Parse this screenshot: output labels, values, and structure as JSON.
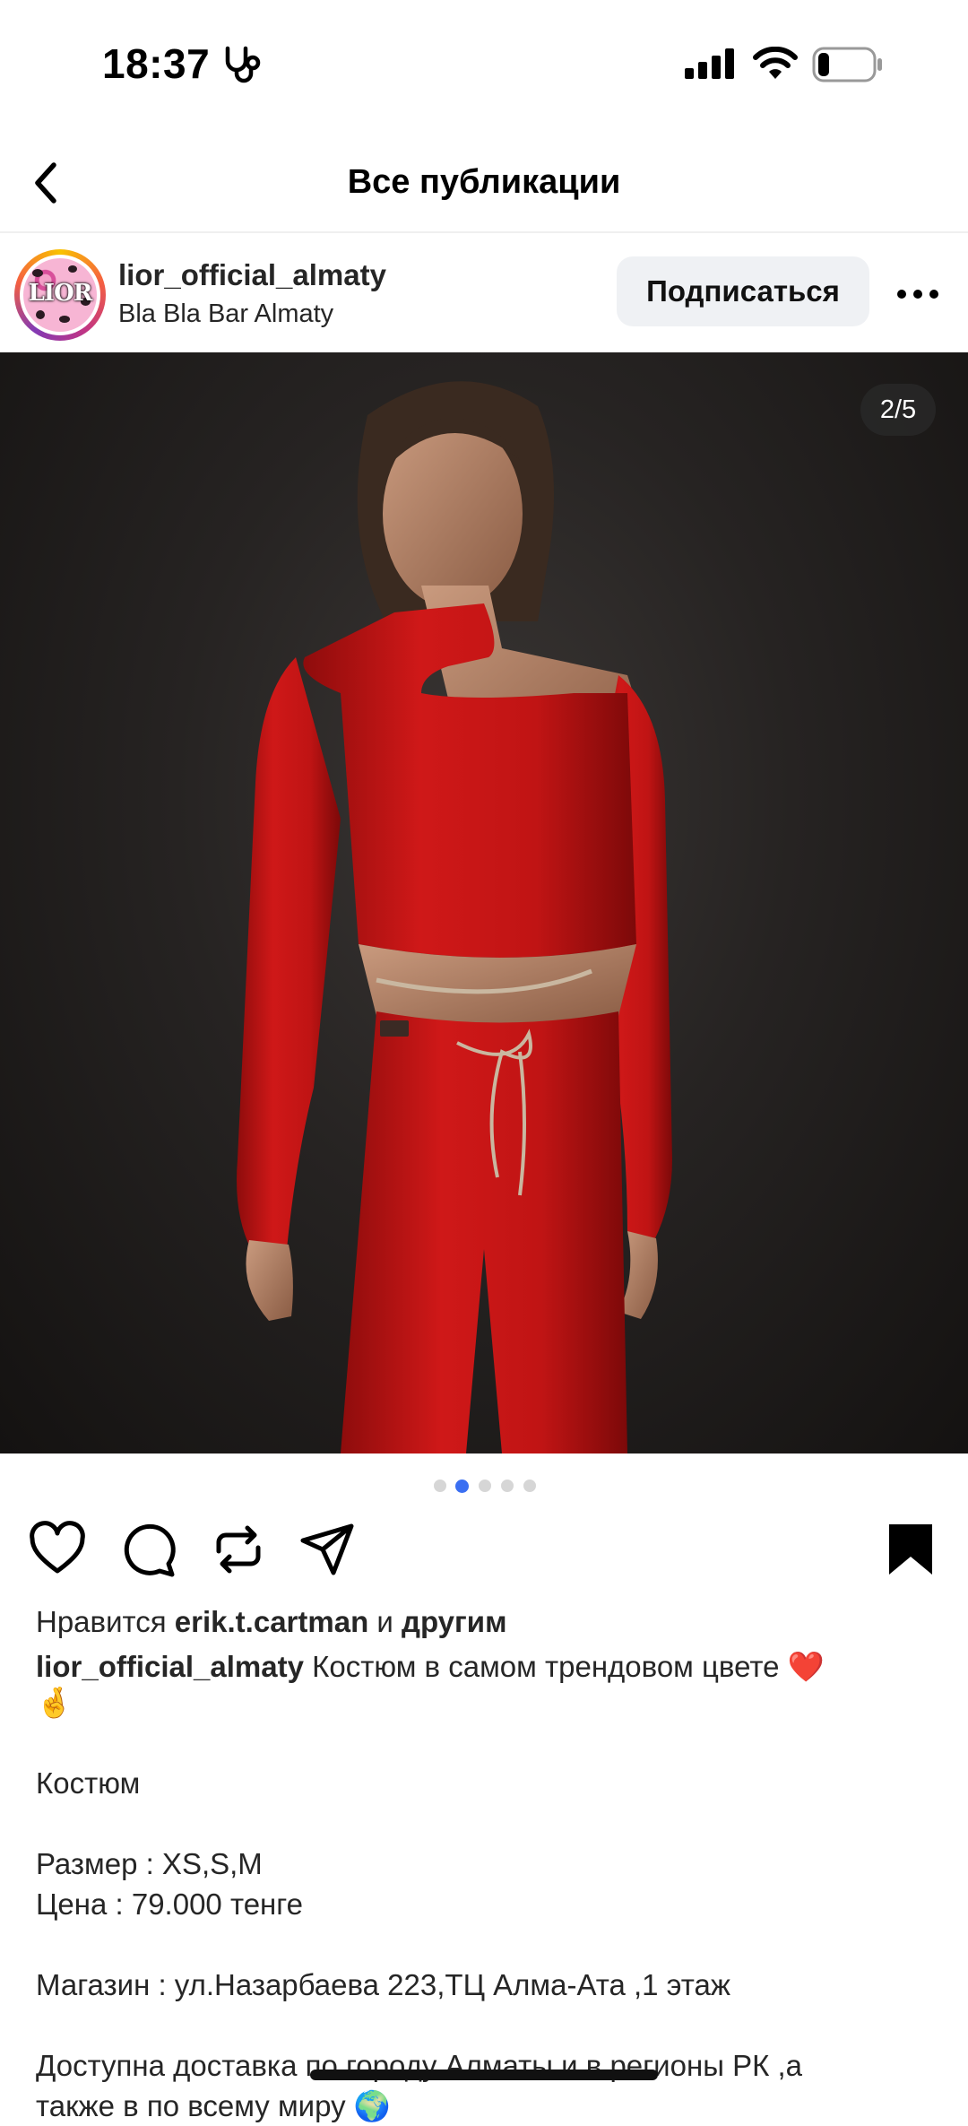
{
  "status_bar": {
    "time": "18:37",
    "battery_level": 0.2
  },
  "nav": {
    "title": "Все публикации"
  },
  "post": {
    "username": "lior_official_almaty",
    "location": "Bla Bla Bar Almaty",
    "avatar_text": "LIOR",
    "follow_label": "Подписаться",
    "counter": "2/5",
    "carousel": {
      "count": 5,
      "active_index": 1
    },
    "likes": {
      "prefix": "Нравится",
      "user": "erik.t.cartman",
      "and": "и",
      "others": "другим"
    },
    "caption": {
      "user": "lior_official_almaty",
      "lines": [
        "Костюм в самом трендовом цвете ❤️",
        "🤞",
        "Костюм",
        "Размер : XS,S,M",
        "Цена : 79.000 тенге",
        "Магазин : ул.Назарбаева 223,ТЦ Алма-Ата ,1 этаж",
        "Доступна доставка по городу Алматы и в регионы РК ,а",
        "также в по всему миру 🌍"
      ]
    }
  },
  "colors": {
    "accent": "#3a6ff2",
    "follow_bg": "#eff1f4",
    "suit": "#c41414"
  },
  "icons": [
    "back-chevron-icon",
    "more-icon",
    "heart-icon",
    "comment-icon",
    "repost-icon",
    "share-icon",
    "bookmark-icon",
    "stethoscope-icon",
    "signal-icon",
    "wifi-icon",
    "battery-icon"
  ]
}
